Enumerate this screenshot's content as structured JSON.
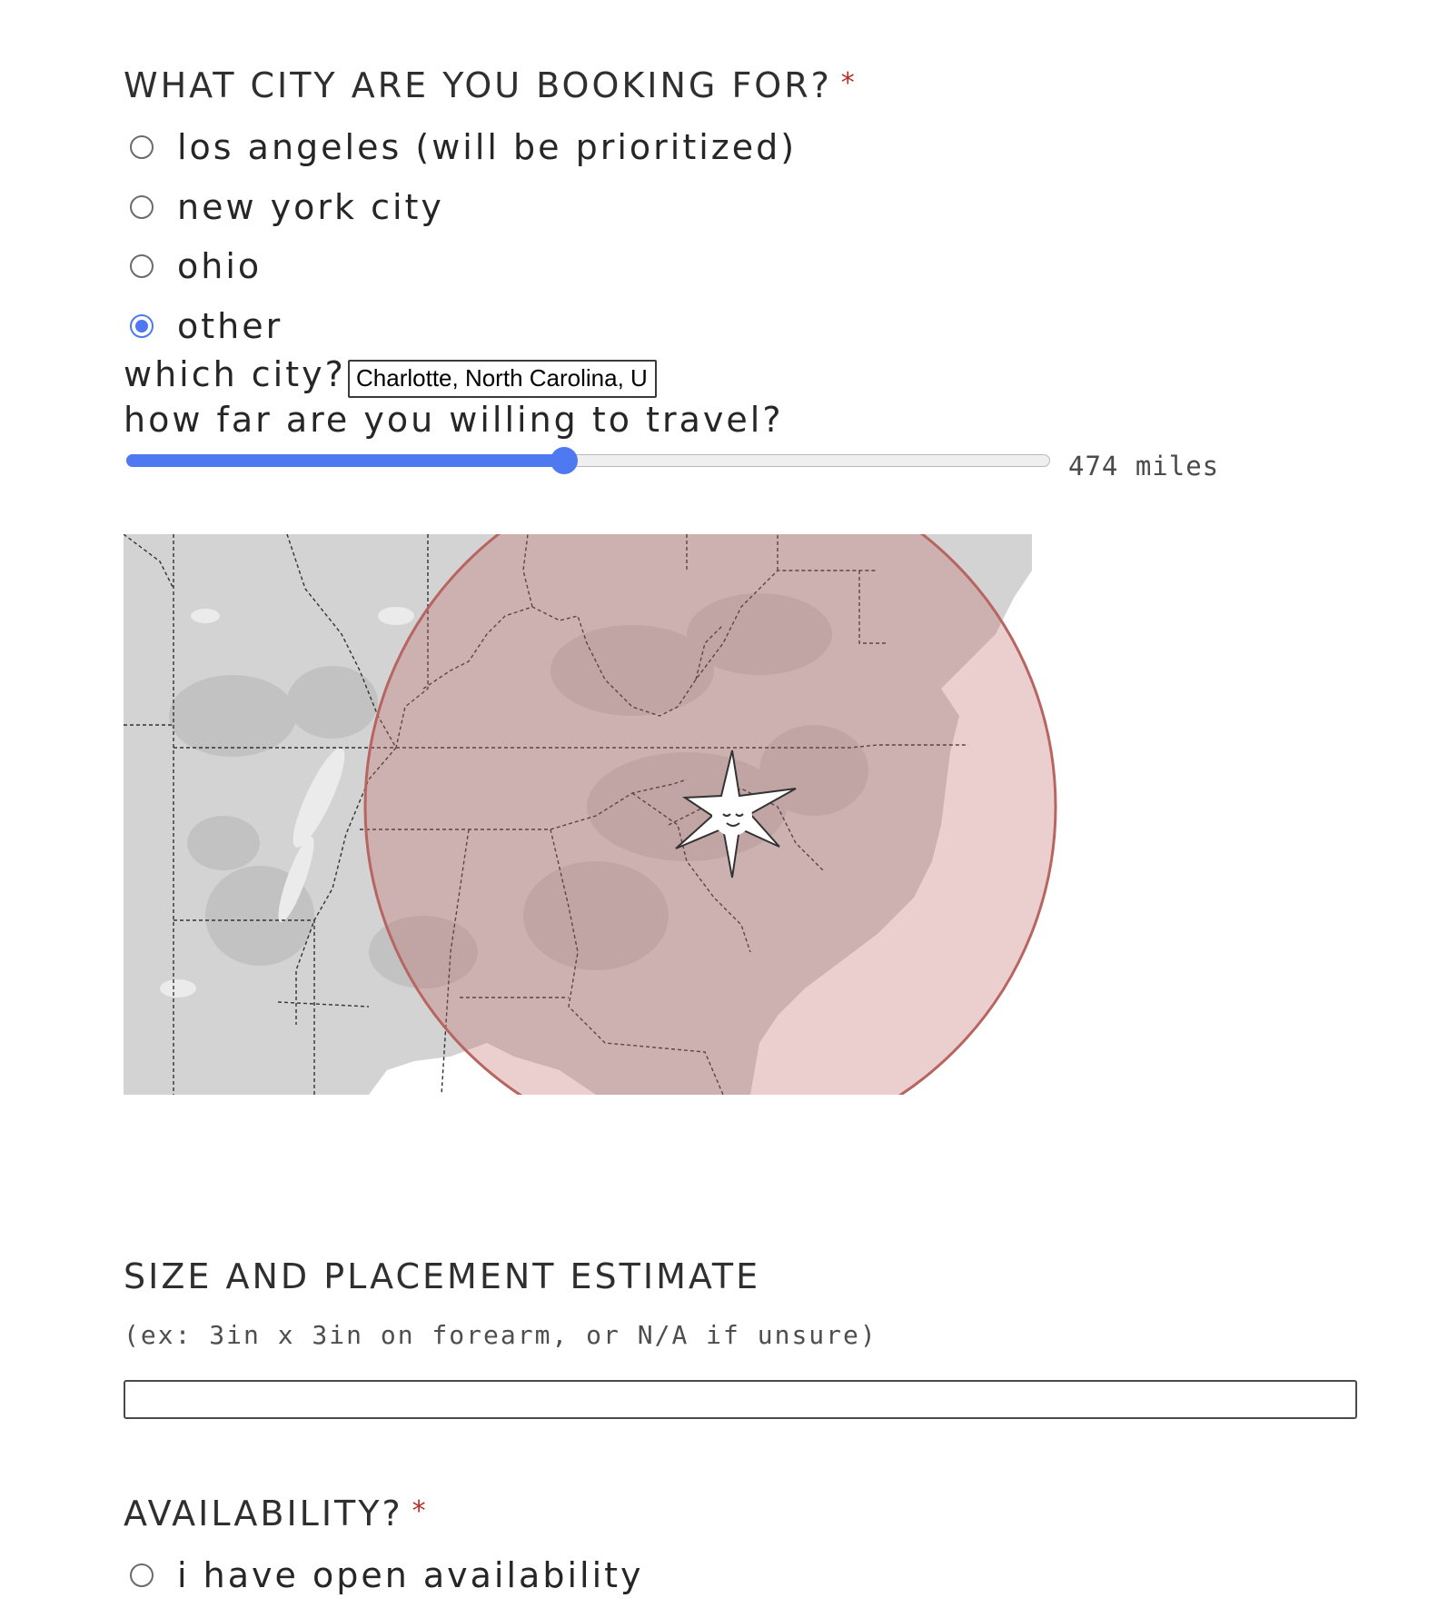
{
  "city_question": {
    "title": "WHAT CITY ARE YOU BOOKING FOR?",
    "required_mark": "*",
    "options": [
      {
        "label": "los angeles (will be prioritized)",
        "selected": false
      },
      {
        "label": "new york city",
        "selected": false
      },
      {
        "label": "ohio",
        "selected": false
      },
      {
        "label": "other",
        "selected": true
      }
    ],
    "other_city_label": "which city?",
    "other_city_value": "Charlotte, North Carolina, U",
    "travel_label": "how far are you willing to travel?",
    "travel_distance": 474,
    "travel_fraction": 0.474,
    "travel_value_text": "474 miles"
  },
  "map": {
    "radius_fill": "#c26a6a",
    "radius_stroke": "#b86460",
    "land_color": "#d3d3d3",
    "marker_icon": "sun-star-icon"
  },
  "size_question": {
    "title": "SIZE AND PLACEMENT ESTIMATE",
    "hint": "(ex: 3in x 3in on forearm, or N/A if unsure)",
    "value": ""
  },
  "availability_question": {
    "title": "AVAILABILITY?",
    "required_mark": "*",
    "options": [
      {
        "label": "i have open availability",
        "selected": false
      }
    ]
  },
  "colors": {
    "accent": "#4e79f0",
    "required": "#b5302a"
  }
}
